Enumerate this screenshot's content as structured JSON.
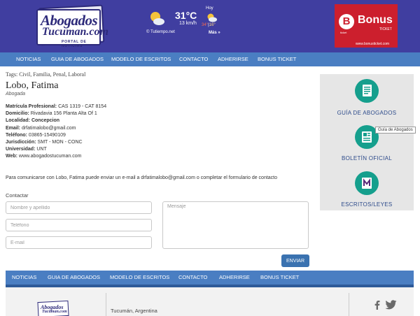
{
  "header": {
    "logo": {
      "line1": "Abogados",
      "line2": "Tucuman.com",
      "tagline": "PORTAL DE NOTICIAS"
    },
    "weather": {
      "temp": "31°C",
      "wind": "13 km/h",
      "credit": "© Tutiempo.net",
      "today_label": "Hoy",
      "max": "34°",
      "separator": "|",
      "min": "16°",
      "more": "Más »"
    },
    "ad": {
      "brand_letter": "B",
      "brand": "Bonus",
      "ticket_small": "ticket",
      "ticket_label": "TICKET",
      "url": "www.bonusticket.com"
    }
  },
  "nav": {
    "items": [
      "NOTICIAS",
      "GUIA DE ABOGADOS",
      "MODELO DE ESCRITOS",
      "CONTACTO",
      "ADHERIRSE",
      "BONUS TICKET"
    ]
  },
  "profile": {
    "tags": "Tags: Civil, Familia, Penal, Laboral",
    "name": "Lobo, Fatima",
    "role": "Abogada",
    "fields": [
      {
        "label": "Matrícula Profesional:",
        "value": " CAS 1319 - CAT 8154"
      },
      {
        "label": "Domicilio:",
        "value": " Rivadavia 156 Planta Alta Of 1"
      },
      {
        "label": "Localidad:",
        "value": " Concepcion"
      },
      {
        "label": "Email:",
        "value": " drfatimalobo@gmail.com"
      },
      {
        "label": "Teléfono:",
        "value": " 03865-15490109"
      },
      {
        "label": "Jurisdicción:",
        "value": " SMT - MON - CONC"
      },
      {
        "label": "Universidad:",
        "value": " UNT"
      },
      {
        "label": "Web:",
        "value": " www.abogadostucuman.com"
      }
    ],
    "message": "Para comunicarse con Lobo, Fatima puede enviar un e-mail a drfatimalobo@gmail.com o completar el formulario de contacto"
  },
  "contact_form": {
    "title": "Contactar",
    "name_placeholder": "Nombre y apellido",
    "phone_placeholder": "Teléfono",
    "email_placeholder": "E-mail",
    "message_placeholder": "Mensaje",
    "send_label": "ENVIAR"
  },
  "sidebar": {
    "items": [
      {
        "label": "GUÍA DE ABOGADOS",
        "icon": "guide-book-icon"
      },
      {
        "label": "BOLETÍN OFICIAL",
        "icon": "newspaper-icon"
      },
      {
        "label": "ESCRITOS/LEYES",
        "icon": "document-m-icon"
      }
    ],
    "tooltip": "Guía de Abogados"
  },
  "footer": {
    "nav_items": [
      "NOTICIAS",
      "GUIA DE ABOGADOS",
      "MODELO DE ESCRITOS",
      "CONTACTO",
      "ADHERIRSE",
      "BONUS TICKET"
    ],
    "location": "Tucumán, Argentina",
    "logo_line1": "Abogados",
    "logo_line2": "Tucuman.com"
  },
  "colors": {
    "header_bg": "#403ea0",
    "nav_bg": "#4a7ec2",
    "accent_teal": "#159f8d",
    "sidebar_text": "#2c4a8a",
    "ad_red": "#cc1f2d"
  }
}
